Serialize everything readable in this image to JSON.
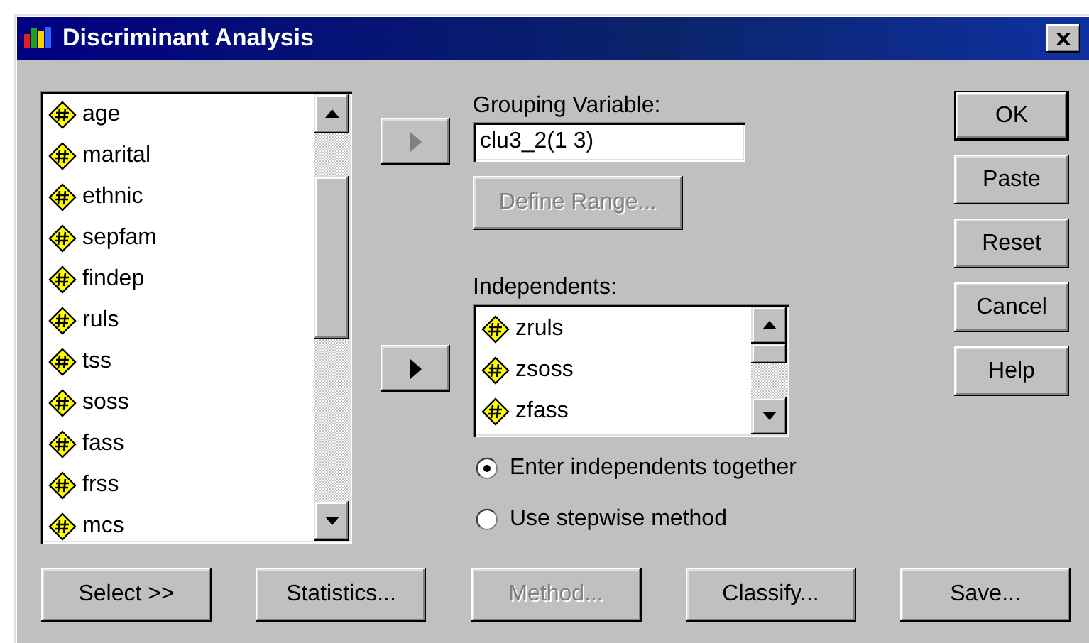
{
  "window": {
    "title": "Discriminant Analysis"
  },
  "variables": [
    "age",
    "marital",
    "ethnic",
    "sepfam",
    "findep",
    "ruls",
    "tss",
    "soss",
    "fass",
    "frss",
    "mcs"
  ],
  "move_buttons": [
    {
      "disabled": true
    },
    {
      "disabled": false
    }
  ],
  "grouping": {
    "label": "Grouping Variable:",
    "value": "clu3_2(1 3)",
    "define_button": {
      "label": "Define Range...",
      "disabled": true
    }
  },
  "independents": {
    "label": "Independents:",
    "items": [
      "zruls",
      "zsoss",
      "zfass"
    ]
  },
  "methods": [
    {
      "label": "Enter independents together",
      "selected": true
    },
    {
      "label": "Use stepwise method",
      "selected": false
    }
  ],
  "side_buttons": [
    {
      "label": "OK",
      "default": true
    },
    {
      "label": "Paste",
      "default": false
    },
    {
      "label": "Reset",
      "default": false
    },
    {
      "label": "Cancel",
      "default": false
    },
    {
      "label": "Help",
      "default": false
    }
  ],
  "bottom_buttons": [
    {
      "label": "Select >>",
      "disabled": false
    },
    {
      "label": "Statistics...",
      "disabled": false
    },
    {
      "label": "Method...",
      "disabled": true
    },
    {
      "label": "Classify...",
      "disabled": false
    },
    {
      "label": "Save...",
      "disabled": false
    }
  ]
}
